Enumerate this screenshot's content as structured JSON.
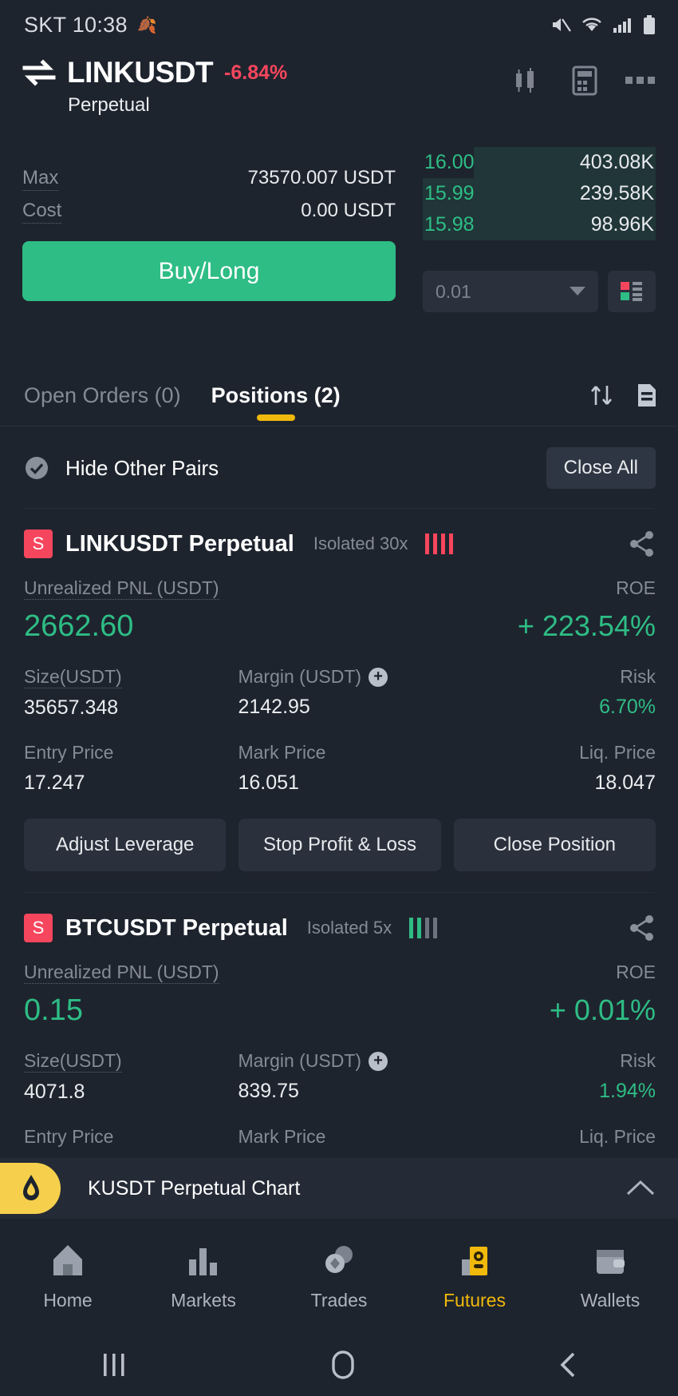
{
  "status_bar": {
    "carrier_time": "SKT 10:38",
    "left_glyph_icon": "flame-icon",
    "icons": [
      "mute-icon",
      "wifi-icon",
      "signal-icon",
      "battery-icon"
    ]
  },
  "header": {
    "swap_icon": "swap-arrows-icon",
    "pair": "LINKUSDT",
    "change_pct": "-6.84%",
    "change_color": "#f6465d",
    "subtitle": "Perpetual",
    "icons": [
      "candlestick-icon",
      "calculator-icon",
      "more-icon"
    ]
  },
  "trade_panel": {
    "max_label": "Max",
    "max_value": "73570.007 USDT",
    "cost_label": "Cost",
    "cost_value": "0.00 USDT",
    "buy_button": "Buy/Long",
    "buy_color": "#2ebd85",
    "orderbook": [
      {
        "price": "16.00",
        "amount": "403.08K",
        "depth_pct": 78
      },
      {
        "price": "15.99",
        "amount": "239.58K",
        "depth_pct": 100
      },
      {
        "price": "15.98",
        "amount": "98.96K",
        "depth_pct": 100
      }
    ],
    "tick_select": "0.01",
    "tick_caret_icon": "caret-down-icon",
    "layout_icon": "orderbook-layout-icon"
  },
  "tabs": {
    "items": [
      {
        "label": "Open Orders (0)",
        "active": false
      },
      {
        "label": "Positions (2)",
        "active": true
      }
    ],
    "accent": "#f0b90b",
    "icons": [
      "sort-updown-icon",
      "document-icon"
    ]
  },
  "positions_header": {
    "hide_other_pairs_label": "Hide Other Pairs",
    "check_icon": "check-circle-icon",
    "close_all_label": "Close All"
  },
  "positions": [
    {
      "side_badge": "S",
      "side_color": "#f6465d",
      "name": "LINKUSDT Perpetual",
      "mode": "Isolated 30x",
      "risk_bars": [
        "red",
        "red",
        "red",
        "red"
      ],
      "share_icon": "share-icon",
      "pnl_label": "Unrealized PNL (USDT)",
      "pnl_value": "2662.60",
      "roe_label": "ROE",
      "roe_value": "+ 223.54%",
      "pnl_color": "#2ebd85",
      "size_label": "Size(USDT)",
      "size_value": "35657.348",
      "margin_label": "Margin (USDT)",
      "margin_add_icon": "plus-circle-icon",
      "margin_value": "2142.95",
      "risk_label": "Risk",
      "risk_value": "6.70%",
      "entry_label": "Entry Price",
      "entry_value": "17.247",
      "mark_label": "Mark Price",
      "mark_value": "16.051",
      "liq_label": "Liq. Price",
      "liq_value": "18.047",
      "buttons": [
        "Adjust Leverage",
        "Stop Profit & Loss",
        "Close Position"
      ]
    },
    {
      "side_badge": "S",
      "side_color": "#f6465d",
      "name": "BTCUSDT Perpetual",
      "mode": "Isolated 5x",
      "risk_bars": [
        "green",
        "green",
        "dim",
        "dim"
      ],
      "share_icon": "share-icon",
      "pnl_label": "Unrealized PNL (USDT)",
      "pnl_value": "0.15",
      "roe_label": "ROE",
      "roe_value": "+ 0.01%",
      "pnl_color": "#2ebd85",
      "size_label": "Size(USDT)",
      "size_value": "4071.8",
      "margin_label": "Margin (USDT)",
      "margin_add_icon": "plus-circle-icon",
      "margin_value": "839.75",
      "risk_label": "Risk",
      "risk_value": "1.94%",
      "entry_label": "Entry Price",
      "entry_value": "",
      "mark_label": "Mark Price",
      "mark_value": "",
      "liq_label": "Liq. Price",
      "liq_value": ""
    }
  ],
  "chart_bar": {
    "pill_icon": "droplet-icon",
    "pill_color": "#f6d04d",
    "text": "KUSDT Perpetual  Chart",
    "collapse_icon": "chevron-up-icon"
  },
  "bottom_nav": {
    "items": [
      {
        "label": "Home",
        "icon": "home-icon",
        "active": false
      },
      {
        "label": "Markets",
        "icon": "bars-icon",
        "active": false
      },
      {
        "label": "Trades",
        "icon": "trades-icon",
        "active": false
      },
      {
        "label": "Futures",
        "icon": "futures-icon",
        "active": true
      },
      {
        "label": "Wallets",
        "icon": "wallet-icon",
        "active": false
      }
    ],
    "accent": "#f0b90b"
  },
  "system_nav": {
    "recent_icon": "recents-icon",
    "home_icon": "home-circle-icon",
    "back_icon": "back-chevron-icon"
  }
}
